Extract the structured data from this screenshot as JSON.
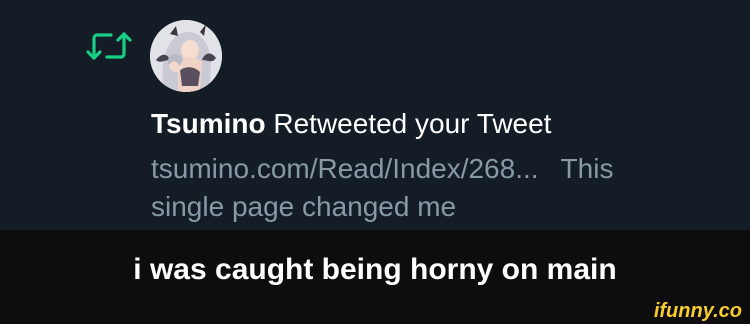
{
  "notification": {
    "type_icon": "retweet-icon",
    "accent_color": "#19cf86",
    "user_name": "Tsumino",
    "action_text": "Retweeted your Tweet",
    "link_text": "tsumino.com/Read/Index/268...",
    "tweet_text_start": "This",
    "tweet_text_rest": "single page changed me"
  },
  "caption": {
    "text": "i was caught being horny on main"
  },
  "watermark": {
    "text": "ifunny.co",
    "color": "#f7cc2f"
  }
}
